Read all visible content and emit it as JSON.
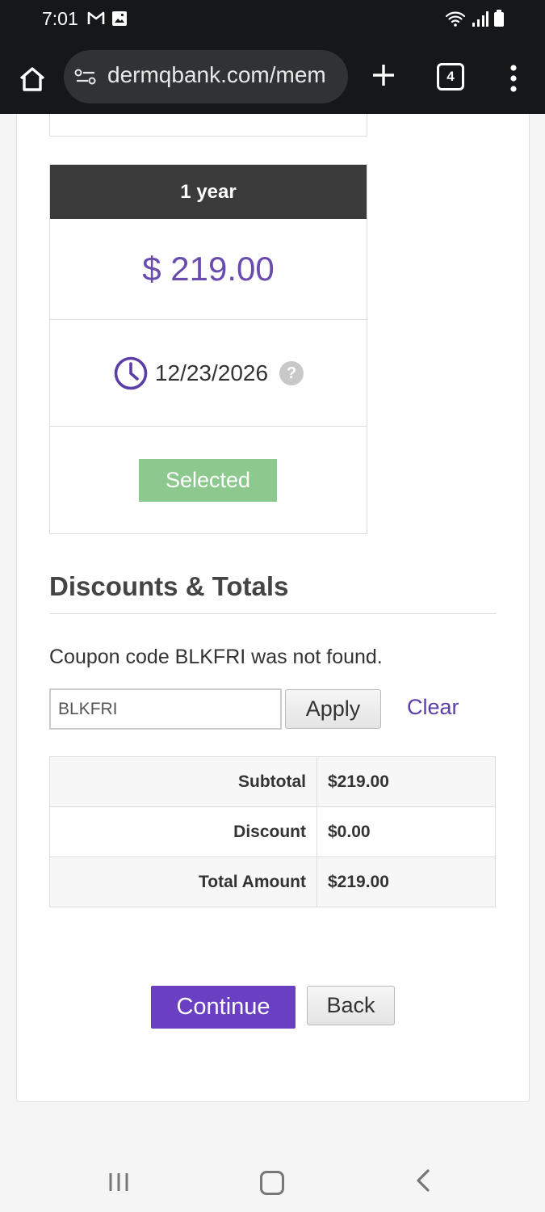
{
  "status_bar": {
    "time": "7:01",
    "left_icons": [
      "gmail-icon",
      "image-icon"
    ],
    "right_icons": [
      "wifi-icon",
      "signal-icon",
      "battery-icon"
    ]
  },
  "browser": {
    "url": "dermqbank.com/mem",
    "tab_count": "4"
  },
  "plan": {
    "term": "1 year",
    "price": "$ 219.00",
    "expiry_date": "12/23/2026",
    "help_glyph": "?",
    "selected_label": "Selected"
  },
  "discounts": {
    "heading": "Discounts & Totals",
    "coupon_message": "Coupon code BLKFRI was not found.",
    "coupon_value": "BLKFRI",
    "apply_label": "Apply",
    "clear_label": "Clear"
  },
  "totals": {
    "rows": [
      {
        "label": "Subtotal",
        "value": "$219.00"
      },
      {
        "label": "Discount",
        "value": "$0.00"
      },
      {
        "label": "Total Amount",
        "value": "$219.00"
      }
    ]
  },
  "actions": {
    "continue_label": "Continue",
    "back_label": "Back"
  },
  "colors": {
    "accent": "#6a3fc1",
    "price": "#6a4caf",
    "selected": "#8dc98e",
    "header": "#3b3b3b"
  }
}
